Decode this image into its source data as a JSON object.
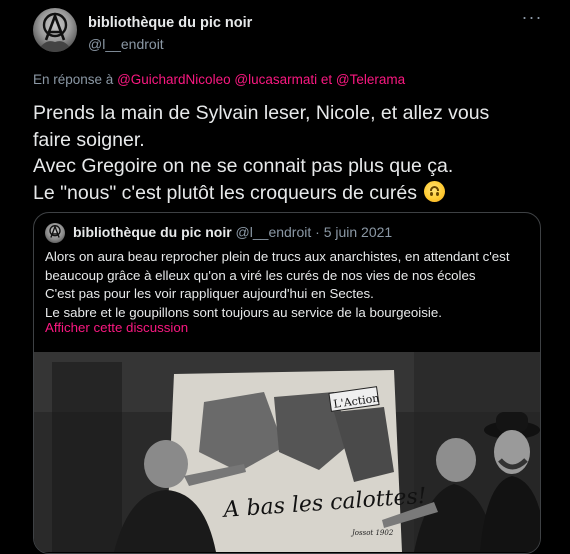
{
  "author": {
    "name": "bibliothèque du pic noir",
    "handle": "@l__endroit"
  },
  "more_label": "···",
  "reply": {
    "prefix": "En réponse à",
    "mentions": [
      "@GuichardNicoleo",
      "@lucasarmati",
      "@Telerama"
    ],
    "conjunction": "et"
  },
  "tweet": {
    "lines": [
      "Prends la main de Sylvain leser, Nicole, et allez vous",
      "faire soigner.",
      "Avec Gregoire on ne se connait pas plus que ça.",
      "Le \"nous\" c'est plutôt les croqueurs de curés"
    ],
    "emoji": "upside-down-face-emoji"
  },
  "quote": {
    "name": "bibliothèque du pic noir",
    "handle": "@l__endroit",
    "separator": "·",
    "date": "5 juin 2021",
    "lines": [
      "Alors on aura beau reprocher plein de trucs aux anarchistes, en attendant c'est",
      "beaucoup grâce à elleux qu'on a viré les curés de nos vies de nos écoles",
      "C'est pas pour les voir rappliquer aujourd'hui en Sectes.",
      "Le sabre et le goupillons sont toujours au service de la bourgeoisie."
    ],
    "show_thread": "Afficher cette discussion",
    "media": {
      "poster_headline": "A bas les calottes!",
      "poster_badge": "L'Action",
      "poster_signature": "Jossot 1902"
    }
  },
  "colors": {
    "background": "#000000",
    "text": "#e7e9ea",
    "secondary": "#8b98a5",
    "accent": "#f91880",
    "border": "#3e4144"
  }
}
